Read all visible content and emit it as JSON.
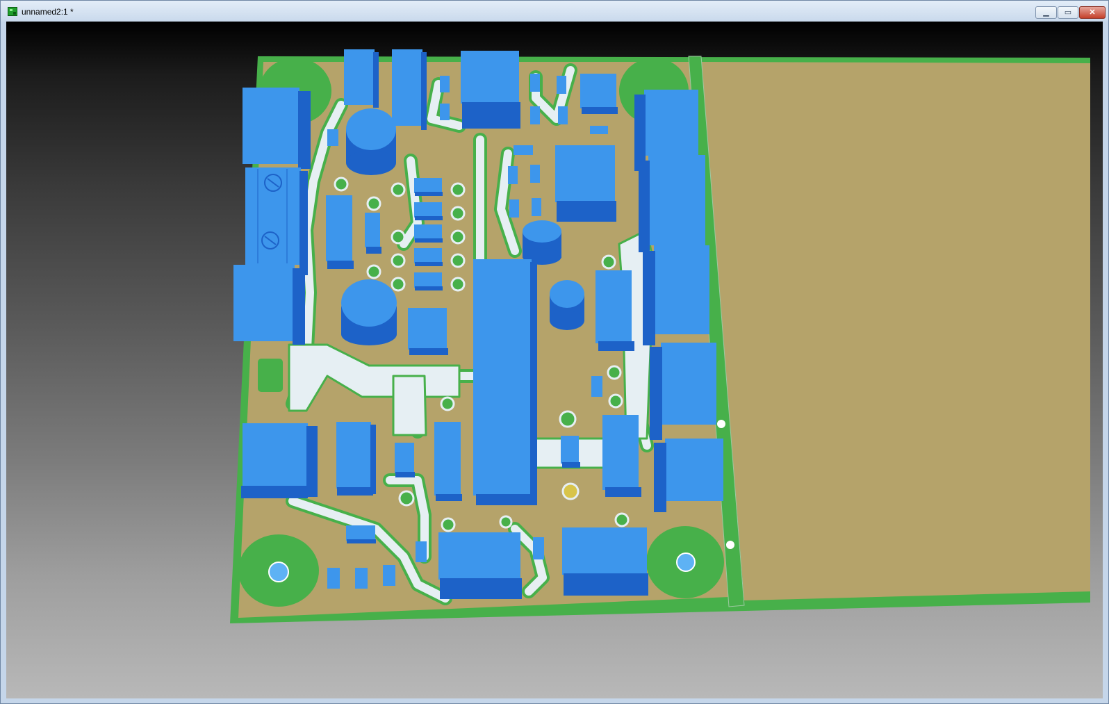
{
  "window": {
    "title": "unnamed2:1 *",
    "minimize_symbol": "▁",
    "maximize_symbol": "▭",
    "close_symbol": "✕"
  },
  "icons": {
    "app": "pcb-board-icon",
    "minimize": "minimize-icon",
    "maximize": "maximize-icon",
    "close": "close-icon"
  },
  "colors": {
    "board_green": "#47b04a",
    "copper": "#b5a36a",
    "trace": "#e6eff3",
    "component": "#3d96ec",
    "component_side": "#1d62c8"
  }
}
